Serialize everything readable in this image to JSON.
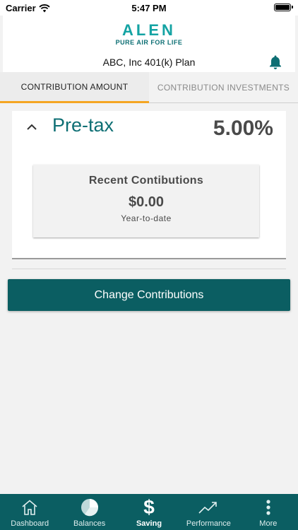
{
  "status_bar": {
    "carrier": "Carrier",
    "time": "5:47 PM"
  },
  "header": {
    "brand": "ALEN",
    "tagline": "PURE AIR FOR LIFE",
    "plan_name": "ABC, Inc 401(k) Plan",
    "accent_color": "#0e6f74",
    "bell_icon": "bell-icon"
  },
  "tabs": [
    {
      "label": "CONTRIBUTION AMOUNT",
      "active": true
    },
    {
      "label": "CONTRIBUTION INVESTMENTS",
      "active": false
    }
  ],
  "tab_indicator_color": "#f5a623",
  "contribution_card": {
    "title": "Pre-tax",
    "percent": "5.00%",
    "expanded": true,
    "recent": {
      "title": "Recent Contibutions",
      "amount": "$0.00",
      "period": "Year-to-date"
    }
  },
  "change_button": {
    "label": "Change Contributions",
    "color": "#0b5e62"
  },
  "bottom_nav": [
    {
      "label": "Dashboard",
      "icon": "home-icon",
      "active": false
    },
    {
      "label": "Balances",
      "icon": "pie-chart-icon",
      "active": false
    },
    {
      "label": "Saving",
      "icon": "dollar-icon",
      "active": true
    },
    {
      "label": "Performance",
      "icon": "trend-up-icon",
      "active": false
    },
    {
      "label": "More",
      "icon": "more-vertical-icon",
      "active": false
    }
  ]
}
